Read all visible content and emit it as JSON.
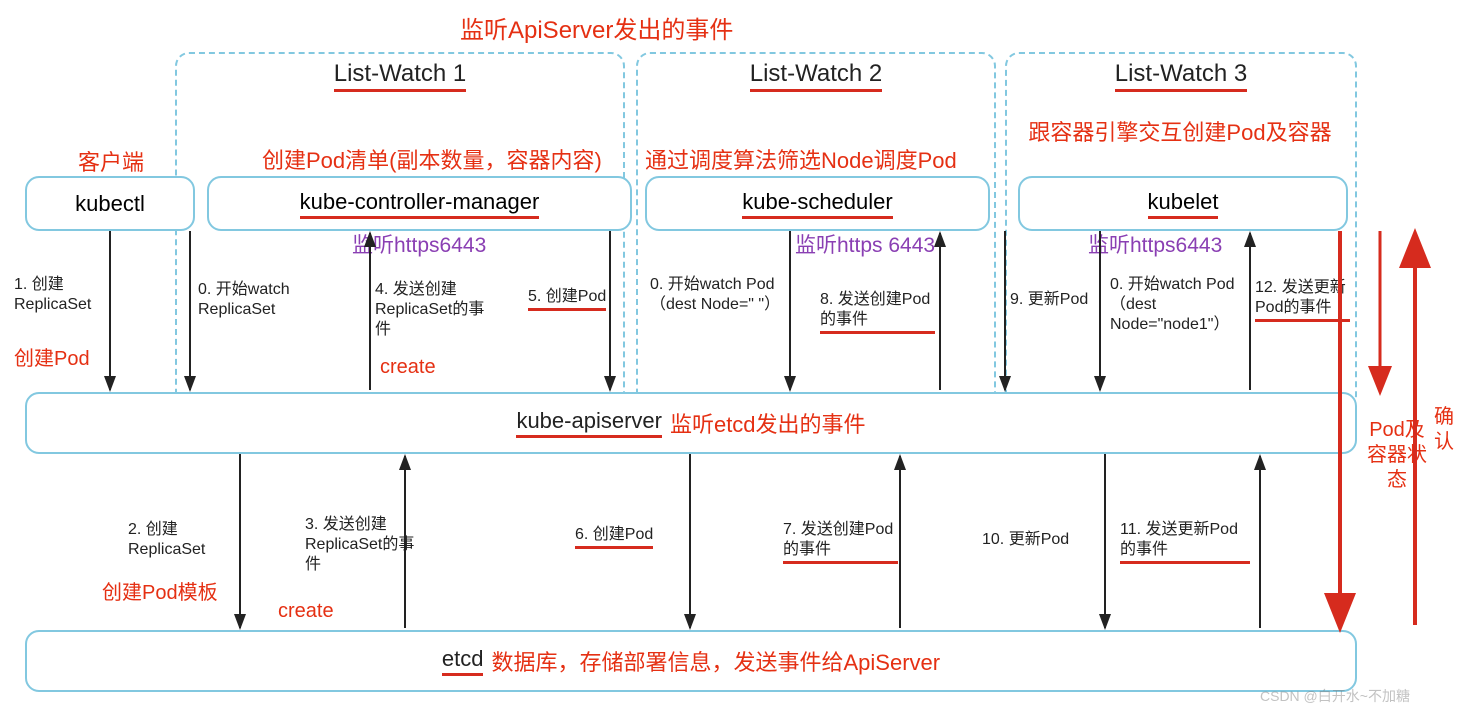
{
  "topTitle": "监听ApiServer发出的事件",
  "listWatch": {
    "lw1": "List-Watch 1",
    "lw2": "List-Watch 2",
    "lw3": "List-Watch 3"
  },
  "clientLabel": "客户端",
  "kubectl": "kubectl",
  "kcm": {
    "name": "kube-controller-manager",
    "note": "创建Pod清单(副本数量，容器内容)",
    "listen": "监听https6443"
  },
  "sched": {
    "name": "kube-scheduler",
    "note": "通过调度算法筛选Node调度Pod",
    "listen": "监听https 6443"
  },
  "kubelet": {
    "name": "kubelet",
    "note": "跟容器引擎交互创建Pod及容器",
    "listen": "监听https6443"
  },
  "apiserver": {
    "name": "kube-apiserver",
    "note": "监听etcd发出的事件"
  },
  "etcd": {
    "name": "etcd",
    "note": "数据库，存储部署信息，发送事件给ApiServer"
  },
  "steps": {
    "s1": "1. 创建ReplicaSet",
    "s0_kcm": "0. 开始watch ReplicaSet",
    "s4": "4. 发送创建ReplicaSet的事件",
    "s5": "5. 创建Pod",
    "s0_sched": "0. 开始watch Pod（dest Node=\" \"）",
    "s8": "8. 发送创建Pod的事件",
    "s9": "9. 更新Pod",
    "s0_kubelet": "0. 开始watch Pod（dest Node=\"node1\"）",
    "s12": "12. 发送更新Pod的事件",
    "s2": "2. 创建ReplicaSet",
    "s3": "3. 发送创建ReplicaSet的事件",
    "s6": "6. 创建Pod",
    "s7": "7. 发送创建Pod的事件",
    "s10": "10. 更新Pod",
    "s11": "11. 发送更新Pod的事件"
  },
  "redNotes": {
    "createPod1": "创建Pod",
    "create1": "create",
    "createPodTemplate": "创建Pod模板",
    "create2": "create",
    "podStatus": "Pod及容器状态",
    "confirm": "确认"
  },
  "watermark": "CSDN @白开水~不加糖"
}
